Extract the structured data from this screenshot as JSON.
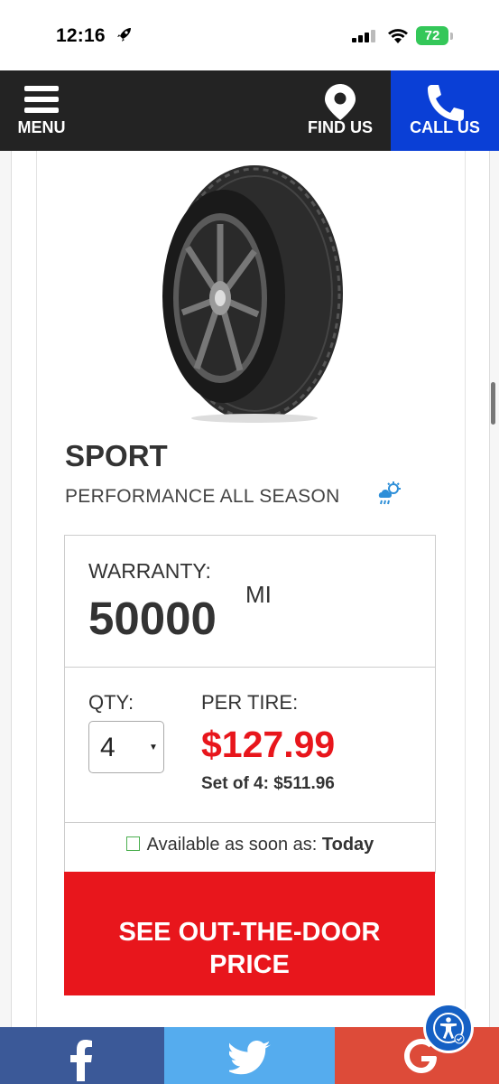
{
  "status_bar": {
    "time": "12:16",
    "battery": "72"
  },
  "nav": {
    "menu_label": "MENU",
    "find_label": "FIND US",
    "call_label": "CALL US"
  },
  "product": {
    "name": "SPORT",
    "category": "PERFORMANCE ALL SEASON"
  },
  "warranty": {
    "label": "WARRANTY:",
    "value": "50000",
    "unit": "MI"
  },
  "pricing": {
    "qty_label": "QTY:",
    "qty_value": "4",
    "per_tire_label": "PER TIRE:",
    "per_tire_price": "$127.99",
    "set_label": "Set of 4: $511.96"
  },
  "availability": {
    "label": "Available as soon as:",
    "value": "Today"
  },
  "cta": {
    "line1": "SEE OUT-THE-DOOR",
    "line2": "PRICE"
  },
  "colors": {
    "nav_bg": "#232323",
    "call_bg": "#0a3fd6",
    "price_red": "#e8161c",
    "facebook": "#3b5998",
    "twitter": "#55acee",
    "google": "#dd4b39"
  },
  "icons": [
    "rocket-icon",
    "signal-icon",
    "wifi-icon",
    "menu-icon",
    "map-pin-icon",
    "phone-icon",
    "weather-icon",
    "facebook-icon",
    "twitter-icon",
    "google-icon",
    "accessibility-icon"
  ]
}
